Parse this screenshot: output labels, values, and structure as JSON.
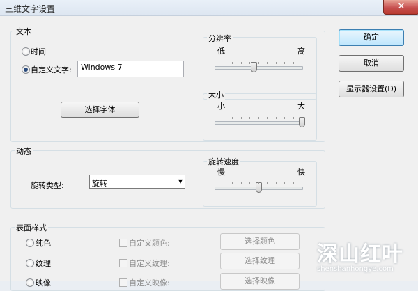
{
  "window": {
    "title": "三维文字设置",
    "close_glyph": "✕"
  },
  "text_group": {
    "label": "文本",
    "time_option": "时间",
    "custom_option": "自定义文字:",
    "custom_value": "Windows 7",
    "choose_font_button": "选择字体"
  },
  "resolution": {
    "label": "分辨率",
    "low": "低",
    "high": "高",
    "level": 0.45
  },
  "size": {
    "label": "大小",
    "small": "小",
    "large": "大",
    "level": 1.0
  },
  "motion": {
    "label": "动态",
    "spin_type_label": "旋转类型:",
    "spin_type_value": "旋转",
    "speed_label": "旋转速度",
    "slow": "慢",
    "fast": "快",
    "speed_level": 0.5
  },
  "surface": {
    "label": "表面样式",
    "solid_option": "纯色",
    "texture_option": "纹理",
    "reflection_option": "映像",
    "custom_color_check": "自定义颜色:",
    "custom_texture_check": "自定义纹理:",
    "custom_reflection_check": "自定义映像:",
    "choose_color_button": "选择颜色",
    "choose_texture_button": "选择纹理",
    "choose_reflection_button": "选择映像"
  },
  "actions": {
    "ok": "确定",
    "cancel": "取消",
    "display_settings": "显示器设置(D)"
  },
  "watermark": {
    "main": "深山红叶",
    "sub": "shenshanhongye.com"
  },
  "colors": {
    "accent": "#3c7fb1",
    "title_bg": "#dde6f1",
    "client_bg": "#f0f0f0"
  }
}
